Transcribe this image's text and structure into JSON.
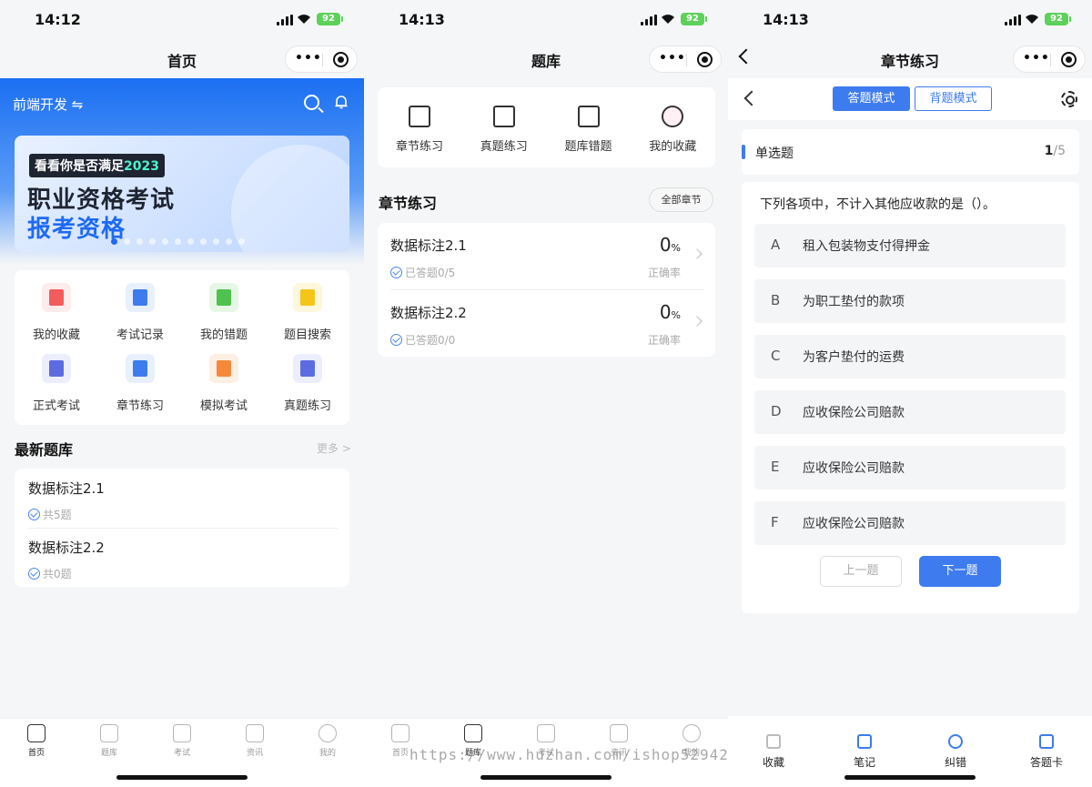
{
  "screen1": {
    "time": "14:12",
    "battery": "92",
    "nav_title": "首页",
    "top_title": "前端开发 ⇋",
    "banner": {
      "tag_prefix": "看看你是否满足",
      "tag_year": "2023",
      "line1": "职业资格考试",
      "line2": "报考资格",
      "dots": 11,
      "active_dot": 0
    },
    "grid": [
      {
        "label": "我的收藏",
        "icon": "favorite-icon",
        "color": "#f25c5c",
        "bg": "#fdecec"
      },
      {
        "label": "考试记录",
        "icon": "exam-record-icon",
        "color": "#3d7bef",
        "bg": "#e8f0fe"
      },
      {
        "label": "我的错题",
        "icon": "wrong-question-icon",
        "color": "#4fc14f",
        "bg": "#e6f7e6"
      },
      {
        "label": "题目搜索",
        "icon": "question-search-icon",
        "color": "#f5c518",
        "bg": "#fdf7dc"
      },
      {
        "label": "正式考试",
        "icon": "formal-exam-icon",
        "color": "#5b6be0",
        "bg": "#eceefd"
      },
      {
        "label": "章节练习",
        "icon": "chapter-practice-icon",
        "color": "#3d7bef",
        "bg": "#e8f0fe"
      },
      {
        "label": "模拟考试",
        "icon": "mock-exam-icon",
        "color": "#f5893b",
        "bg": "#feefe3"
      },
      {
        "label": "真题练习",
        "icon": "real-exam-icon",
        "color": "#5b6be0",
        "bg": "#eceefd"
      }
    ],
    "section_title": "最新题库",
    "section_more": "更多",
    "list": [
      {
        "title": "数据标注2.1",
        "sub": "共5题"
      },
      {
        "title": "数据标注2.2",
        "sub": "共0题"
      }
    ]
  },
  "screen2": {
    "time": "14:13",
    "battery": "92",
    "nav_title": "题库",
    "modules": [
      {
        "label": "章节练习",
        "icon": "edit-icon"
      },
      {
        "label": "真题练习",
        "icon": "document-icon"
      },
      {
        "label": "题库错题",
        "icon": "wrong-bank-icon"
      },
      {
        "label": "我的收藏",
        "icon": "heart-icon"
      }
    ],
    "section_title": "章节练习",
    "all_chapters": "全部章节",
    "chapters": [
      {
        "title": "数据标注2.1",
        "sub": "已答题0/5",
        "pct": "0",
        "pct_unit": "%",
        "rate_label": "正确率"
      },
      {
        "title": "数据标注2.2",
        "sub": "已答题0/0",
        "pct": "0",
        "pct_unit": "%",
        "rate_label": "正确率"
      }
    ],
    "watermark": "https://www.huzhan.com/ishop52942"
  },
  "screen3": {
    "time": "14:13",
    "battery": "92",
    "nav_title": "章节练习",
    "mode_answer": "答题模式",
    "mode_recite": "背题模式",
    "qtype": "单选题",
    "qcurrent": "1",
    "qtotal": "/5",
    "question": "下列各项中，不计入其他应收款的是（）。",
    "options": [
      {
        "key": "A",
        "text": "租入包装物支付得押金"
      },
      {
        "key": "B",
        "text": "为职工垫付的款项"
      },
      {
        "key": "C",
        "text": "为客户垫付的运费"
      },
      {
        "key": "D",
        "text": "应收保险公司赔款"
      },
      {
        "key": "E",
        "text": "应收保险公司赔款"
      },
      {
        "key": "F",
        "text": "应收保险公司赔款"
      }
    ],
    "prev": "上一题",
    "next": "下一题",
    "tools": [
      {
        "label": "收藏",
        "icon": "star-icon"
      },
      {
        "label": "笔记",
        "icon": "pen-icon"
      },
      {
        "label": "纠错",
        "icon": "magnify-plus-icon"
      },
      {
        "label": "答题卡",
        "icon": "answer-card-icon"
      }
    ]
  },
  "tabbar": [
    {
      "label": "首页",
      "icon": "home-icon"
    },
    {
      "label": "题库",
      "icon": "question-bank-icon"
    },
    {
      "label": "考试",
      "icon": "exam-icon"
    },
    {
      "label": "资讯",
      "icon": "news-icon"
    },
    {
      "label": "我的",
      "icon": "profile-icon"
    }
  ],
  "accent_color": "#3d7bef"
}
